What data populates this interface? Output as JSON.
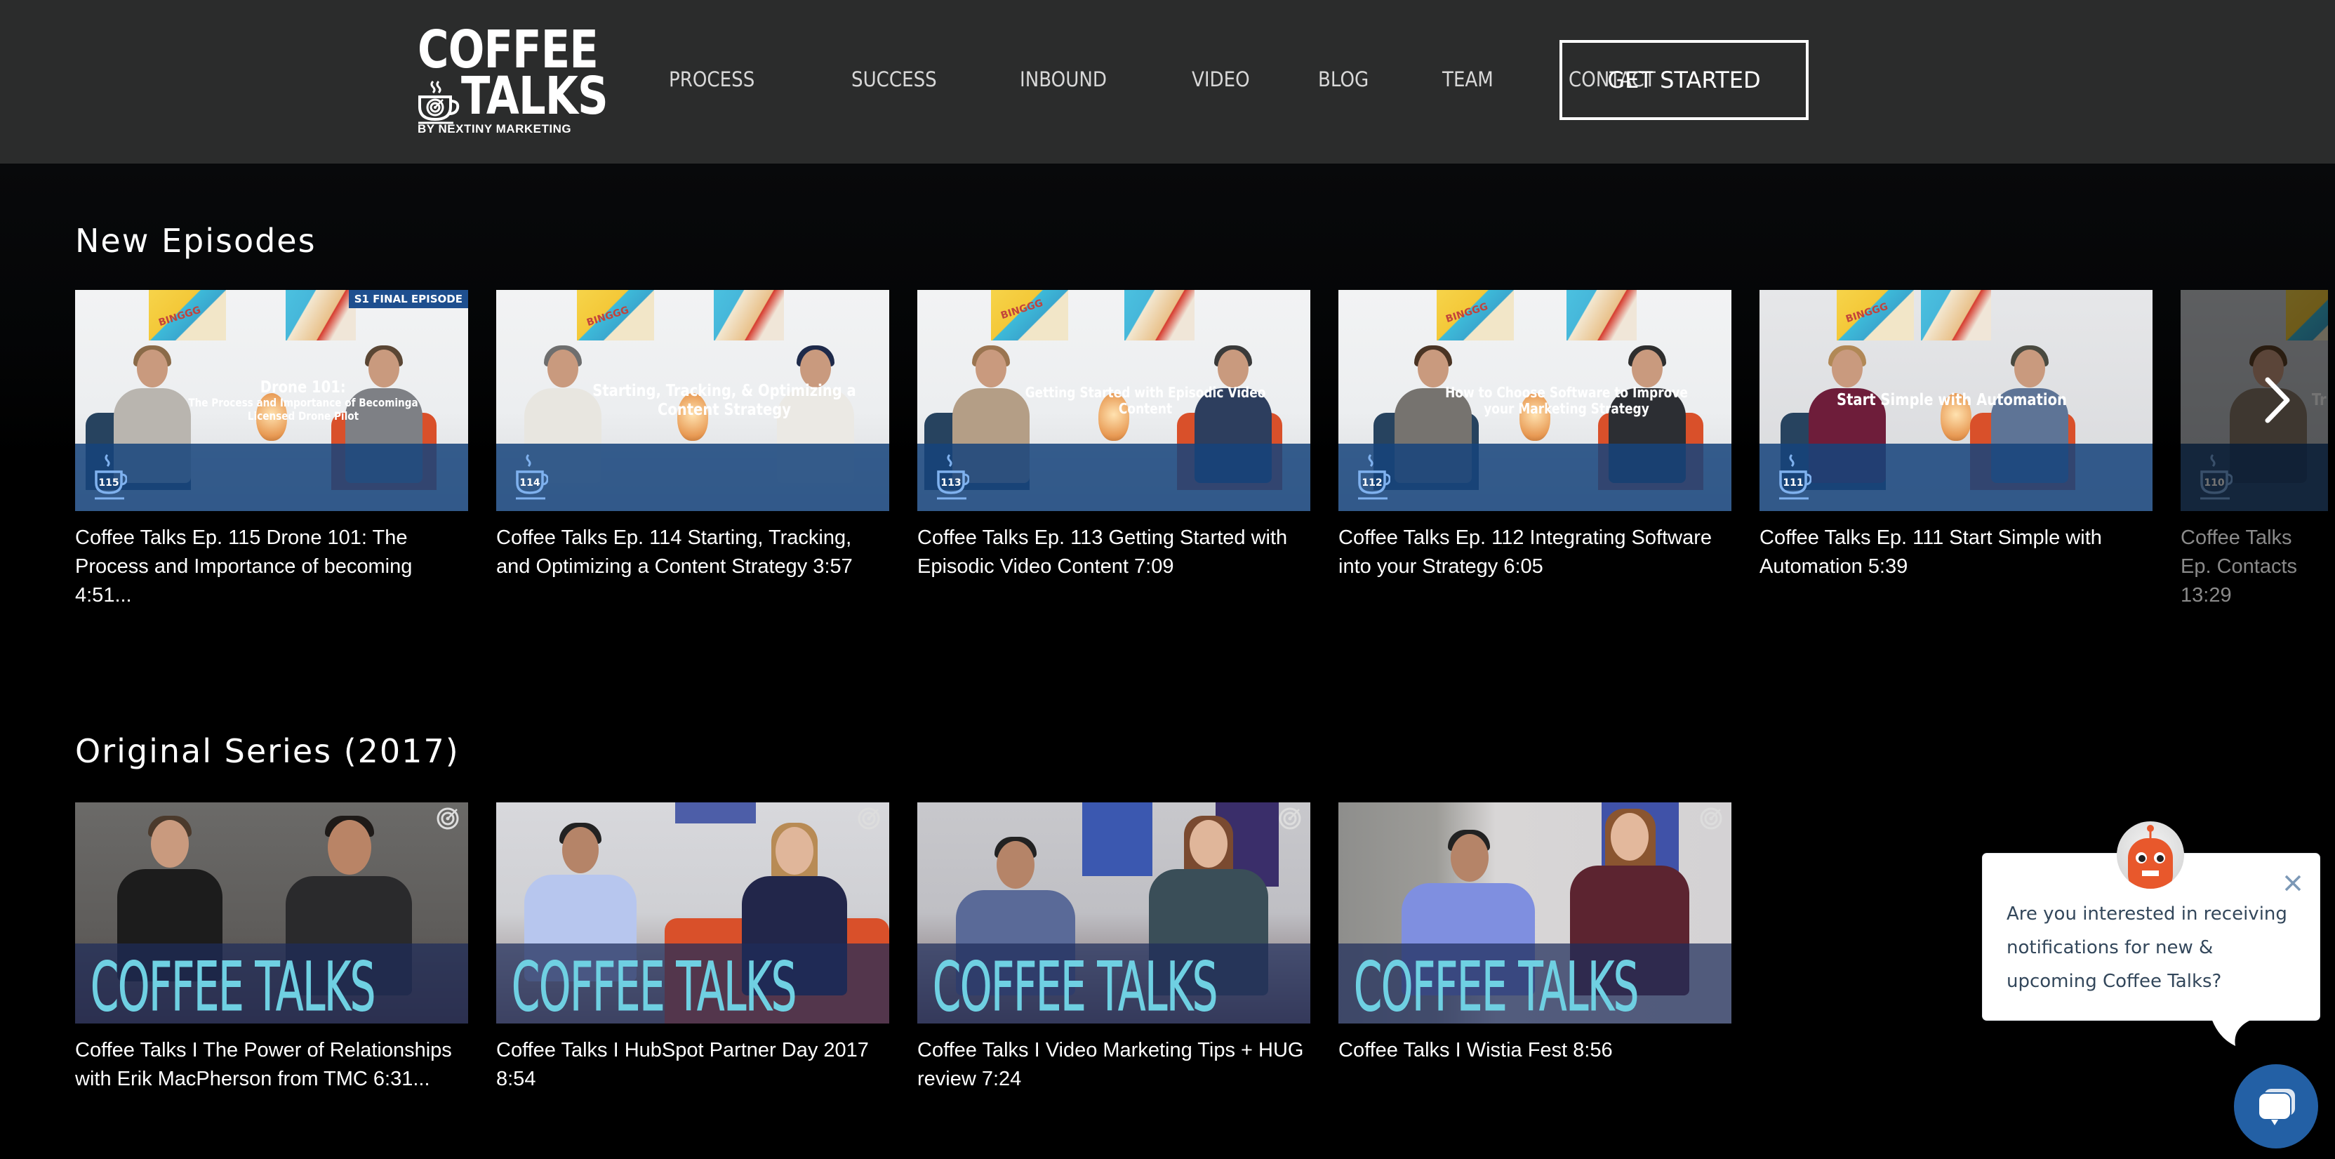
{
  "header": {
    "logo": {
      "line1": "COFFEE",
      "line2": "TALKS",
      "tagline": "BY NEXTINY MARKETING"
    },
    "nav": [
      {
        "label": "PROCESS"
      },
      {
        "label": "SUCCESS"
      },
      {
        "label": "INBOUND"
      },
      {
        "label": "VIDEO"
      },
      {
        "label": "BLOG"
      },
      {
        "label": "TEAM"
      },
      {
        "label": "CONTACT"
      }
    ],
    "cta_label": "GET STARTED"
  },
  "sections": {
    "new_episodes": {
      "title": "New Episodes",
      "items": [
        {
          "episode": "115",
          "badge": "S1 FINAL EPISODE",
          "thumb_title": "Drone 101:",
          "thumb_sub": "The Process and Importance of Becominga Licensed Drone Pilot",
          "caption": "Coffee Talks Ep. 115 Drone 101: The Process and Importance of becoming 4:51..."
        },
        {
          "episode": "114",
          "thumb_title": "Starting, Tracking, & Optimizing a Content Strategy",
          "caption": "Coffee Talks Ep. 114 Starting, Tracking, and Optimizing a Content Strategy 3:57"
        },
        {
          "episode": "113",
          "thumb_title": "Getting Started with Episodic Video Content",
          "caption": "Coffee Talks Ep. 113 Getting Started with Episodic Video Content 7:09"
        },
        {
          "episode": "112",
          "thumb_title": "How to Choose Software to Improve your Marketing Strategy",
          "caption": "Coffee Talks Ep. 112 Integrating Software into your Strategy 6:05"
        },
        {
          "episode": "111",
          "thumb_title": "Start Simple with Automation",
          "caption": "Coffee Talks Ep. 111 Start Simple with Automation 5:39"
        },
        {
          "episode": "110",
          "thumb_title": "Tr",
          "caption": "Coffee Talks Ep. Contacts 13:29"
        }
      ]
    },
    "original_series": {
      "title": "Original Series (2017)",
      "thumb_brand": "COFFEE TALKS",
      "items": [
        {
          "caption": "Coffee Talks I The Power of Relationships with Erik MacPherson from TMC 6:31..."
        },
        {
          "caption": "Coffee Talks I HubSpot Partner Day 2017 8:54"
        },
        {
          "caption": "Coffee Talks I Video Marketing Tips + HUG review 7:24"
        },
        {
          "caption": "Coffee Talks I Wistia Fest 8:56"
        }
      ]
    }
  },
  "carousel": {
    "next_icon": "chevron-right-icon"
  },
  "chat": {
    "message": "Are you interested in receiving notifications for new & upcoming Coffee Talks?",
    "close_icon": "close-icon",
    "avatar": "robot-avatar",
    "launcher_icon": "chat-bubbles-icon"
  },
  "colors": {
    "header_bg": "#2b2c2c",
    "page_bg": "#000000",
    "episode_band": "#16447c",
    "orig_title": "#6fd0e2",
    "chat_launcher": "#2360a5",
    "chat_text": "#33475b",
    "bot_orange": "#e8582c"
  }
}
